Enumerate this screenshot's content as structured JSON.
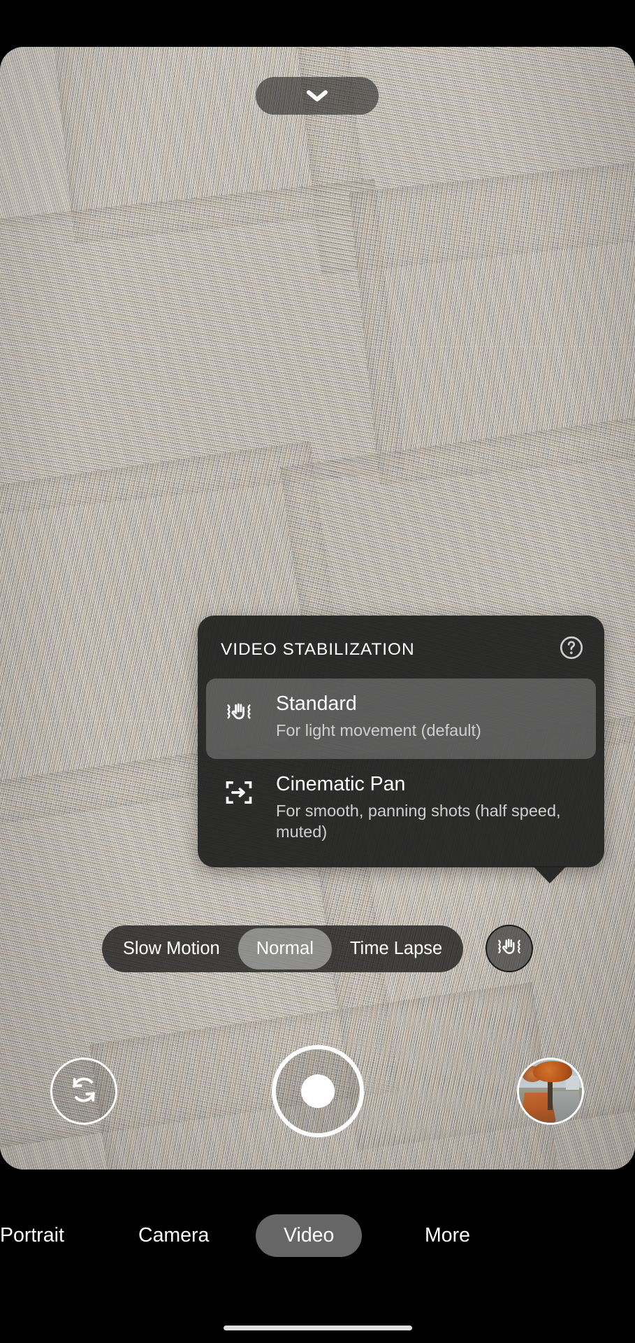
{
  "app": {
    "name": "Camera",
    "viewfinder_description": "Live camera preview showing a grey and beige patterned carpet tile floor"
  },
  "top_bar": {
    "expand_button": {
      "icon": "chevron-down-icon",
      "label": "Expand quick settings"
    }
  },
  "stabilization_dialog": {
    "title": "VIDEO STABILIZATION",
    "help_icon": "help-circle-icon",
    "options": [
      {
        "icon": "hand-shake-stabilization-icon",
        "label": "Standard",
        "description": "For light movement (default)",
        "selected": true
      },
      {
        "icon": "cinematic-pan-icon",
        "label": "Cinematic Pan",
        "description": "For smooth, panning shots (half speed, muted)",
        "selected": false
      }
    ]
  },
  "speed_selector": {
    "options": [
      {
        "label": "Slow Motion",
        "selected": false
      },
      {
        "label": "Normal",
        "selected": true
      },
      {
        "label": "Time Lapse",
        "selected": false
      }
    ],
    "stabilization_button": {
      "icon": "hand-shake-stabilization-icon",
      "label": "Video stabilization"
    }
  },
  "capture_controls": {
    "flip_camera": {
      "icon": "camera-flip-icon",
      "label": "Switch camera"
    },
    "shutter": {
      "icon": "record-button-icon",
      "label": "Start recording"
    },
    "gallery": {
      "icon": "gallery-thumbnail",
      "label": "Last photo: autumn tree lined path"
    }
  },
  "mode_bar": {
    "modes": [
      {
        "label": "Portrait",
        "selected": false
      },
      {
        "label": "Camera",
        "selected": false
      },
      {
        "label": "Video",
        "selected": true
      },
      {
        "label": "More",
        "selected": false
      }
    ]
  },
  "colors": {
    "dialog_background": "#202020",
    "selected_row": "#6a6a6a",
    "accent_text": "#ffffff",
    "secondary_text": "#cfcfcf",
    "pill_background": "#1e1e1e",
    "screen_background": "#000000"
  }
}
